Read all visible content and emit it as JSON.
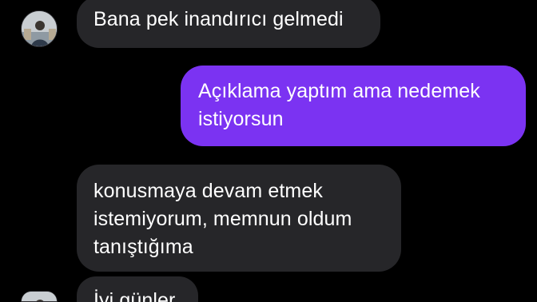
{
  "conversation": {
    "messages": [
      {
        "direction": "incoming",
        "lines": [
          "Bana pek inandırıcı gelmedi"
        ]
      },
      {
        "direction": "outgoing",
        "lines": [
          "Açıklama yaptım ama nedemek",
          "istiyorsun"
        ]
      },
      {
        "direction": "incoming",
        "lines": [
          "konusmaya devam etmek",
          "istemiyorum, memnun oldum",
          "tanıştığıma"
        ]
      },
      {
        "direction": "incoming",
        "lines": [
          "İyi günler"
        ]
      }
    ]
  },
  "colors": {
    "background": "#000000",
    "incoming_bubble": "#262629",
    "outgoing_bubble": "#7b33f2",
    "text": "#ffffff"
  },
  "icons": {
    "sender_avatar": "profile-photo-avatar"
  }
}
